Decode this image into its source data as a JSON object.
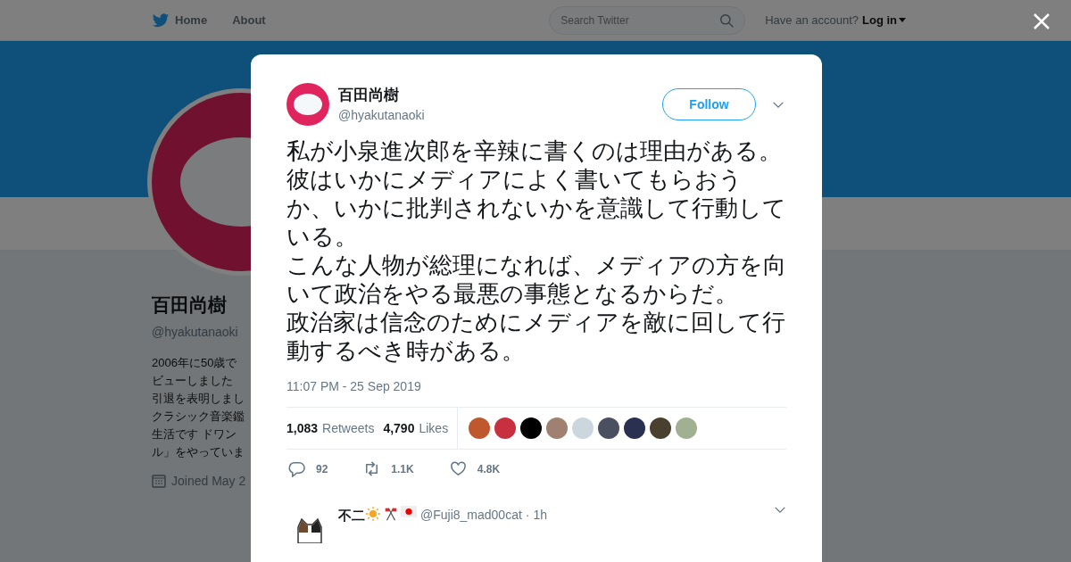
{
  "nav": {
    "items": [
      {
        "label": "Home"
      },
      {
        "label": "About"
      }
    ],
    "search": {
      "placeholder": "Search Twitter"
    },
    "account_prompt": "Have an account?",
    "login": "Log in"
  },
  "profile": {
    "name": "百田尚樹",
    "handle": "@hyakutanaoki",
    "bio_lines": [
      "2006年に50歳で",
      "ビューしました",
      "引退を表明しまし",
      "クラシック音楽鑑",
      "生活です ドワン",
      "ル」をやっていま"
    ],
    "joined": "Joined May 2"
  },
  "tweet": {
    "name": "百田尚樹",
    "handle": "@hyakutanaoki",
    "follow": "Follow",
    "paragraphs": [
      "私が小泉進次郎を辛辣に書くのは理由がある。",
      "彼はいかにメディアによく書いてもらおうか、いかに批判されないかを意識して行動している。",
      "こんな人物が総理になれば、メディアの方を向いて政治をやる最悪の事態となるからだ。",
      "政治家は信念のためにメディアを敵に回して行動するべき時がある。"
    ],
    "time": "11:07 PM - 25 Sep 2019",
    "stats": [
      {
        "count": "1,083",
        "label": "Retweets"
      },
      {
        "count": "4,790",
        "label": "Likes"
      }
    ],
    "likers": [
      {
        "color": "#c0582e"
      },
      {
        "color": "#c83040"
      },
      {
        "color": "#000000"
      },
      {
        "color": "#a08070"
      },
      {
        "color": "#ccd6dd"
      },
      {
        "color": "#4a5060"
      },
      {
        "color": "#2a3050"
      },
      {
        "color": "#4a4030"
      },
      {
        "color": "#a0b090"
      }
    ],
    "actions": [
      {
        "kind": "reply",
        "count": "92"
      },
      {
        "kind": "retweet",
        "count": "1.1K"
      },
      {
        "kind": "like",
        "count": "4.8K"
      }
    ]
  },
  "reply": {
    "name": "不二",
    "handle": "@Fuji8_mad00cat",
    "separator": "·",
    "time": "1h"
  }
}
